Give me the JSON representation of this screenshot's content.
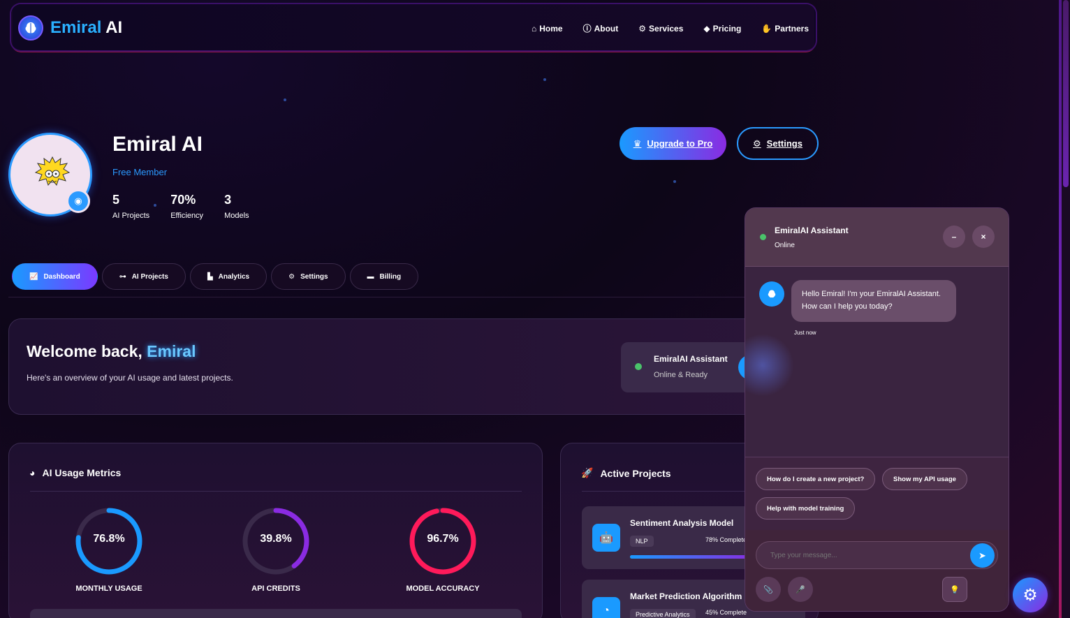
{
  "navbar": {
    "logo_part1": "Emiral",
    "logo_part2": "AI",
    "links": [
      {
        "label": "Home",
        "icon": "home-icon"
      },
      {
        "label": "About",
        "icon": "info-icon"
      },
      {
        "label": "Services",
        "icon": "cogs-icon"
      },
      {
        "label": "Pricing",
        "icon": "tag-icon"
      },
      {
        "label": "Partners",
        "icon": "handshake-icon"
      }
    ]
  },
  "profile": {
    "name": "Emiral AI",
    "tier": "Free Member",
    "stats": [
      {
        "value": "5",
        "label": "AI Projects"
      },
      {
        "value": "70%",
        "label": "Efficiency"
      },
      {
        "value": "3",
        "label": "Models"
      }
    ],
    "upgrade_label": "Upgrade to Pro",
    "settings_label": "Settings"
  },
  "tabs": [
    {
      "label": "Dashboard",
      "icon": "chart-line-icon",
      "active": true
    },
    {
      "label": "AI Projects",
      "icon": "project-diagram-icon",
      "active": false
    },
    {
      "label": "Analytics",
      "icon": "chart-bar-icon",
      "active": false
    },
    {
      "label": "Settings",
      "icon": "cog-icon",
      "active": false
    },
    {
      "label": "Billing",
      "icon": "credit-card-icon",
      "active": false
    }
  ],
  "welcome": {
    "title_prefix": "Welcome back, ",
    "title_name": "Emiral",
    "subtitle": "Here's an overview of your AI usage and latest projects.",
    "assistant_name": "EmiralAI Assistant",
    "assistant_status": "Online & Ready"
  },
  "metrics": {
    "title": "AI Usage Metrics",
    "gauges": [
      {
        "value": "76.8%",
        "pct": 76.8,
        "label": "MONTHLY USAGE",
        "color": "#1a9aff"
      },
      {
        "value": "39.8%",
        "pct": 39.8,
        "label": "API CREDITS",
        "color": "#8a2be2"
      },
      {
        "value": "96.7%",
        "pct": 96.7,
        "label": "MODEL ACCURACY",
        "color": "#ff1a5a"
      }
    ]
  },
  "projects": {
    "title": "Active Projects",
    "items": [
      {
        "name": "Sentiment Analysis Model",
        "tag": "NLP",
        "progress_text": "78% Complete",
        "progress": 78
      },
      {
        "name": "Market Prediction Algorithm",
        "tag": "Predictive Analytics",
        "progress_text": "45% Complete",
        "progress": 45
      }
    ]
  },
  "chat": {
    "title": "EmiralAI Assistant",
    "status": "Online",
    "minimize": "–",
    "close": "×",
    "bot_message": "Hello Emiral! I'm your EmiralAI Assistant. How can I help you today?",
    "bot_time": "Just now",
    "suggestions": [
      "How do I create a new project?",
      "Show my API usage",
      "Help with model training"
    ],
    "input_placeholder": "Type your message..."
  },
  "colors": {
    "accent_blue": "#1a9aff",
    "accent_purple": "#8a2be2",
    "accent_pink": "#ff1a5a",
    "online_green": "#4ac26a"
  }
}
